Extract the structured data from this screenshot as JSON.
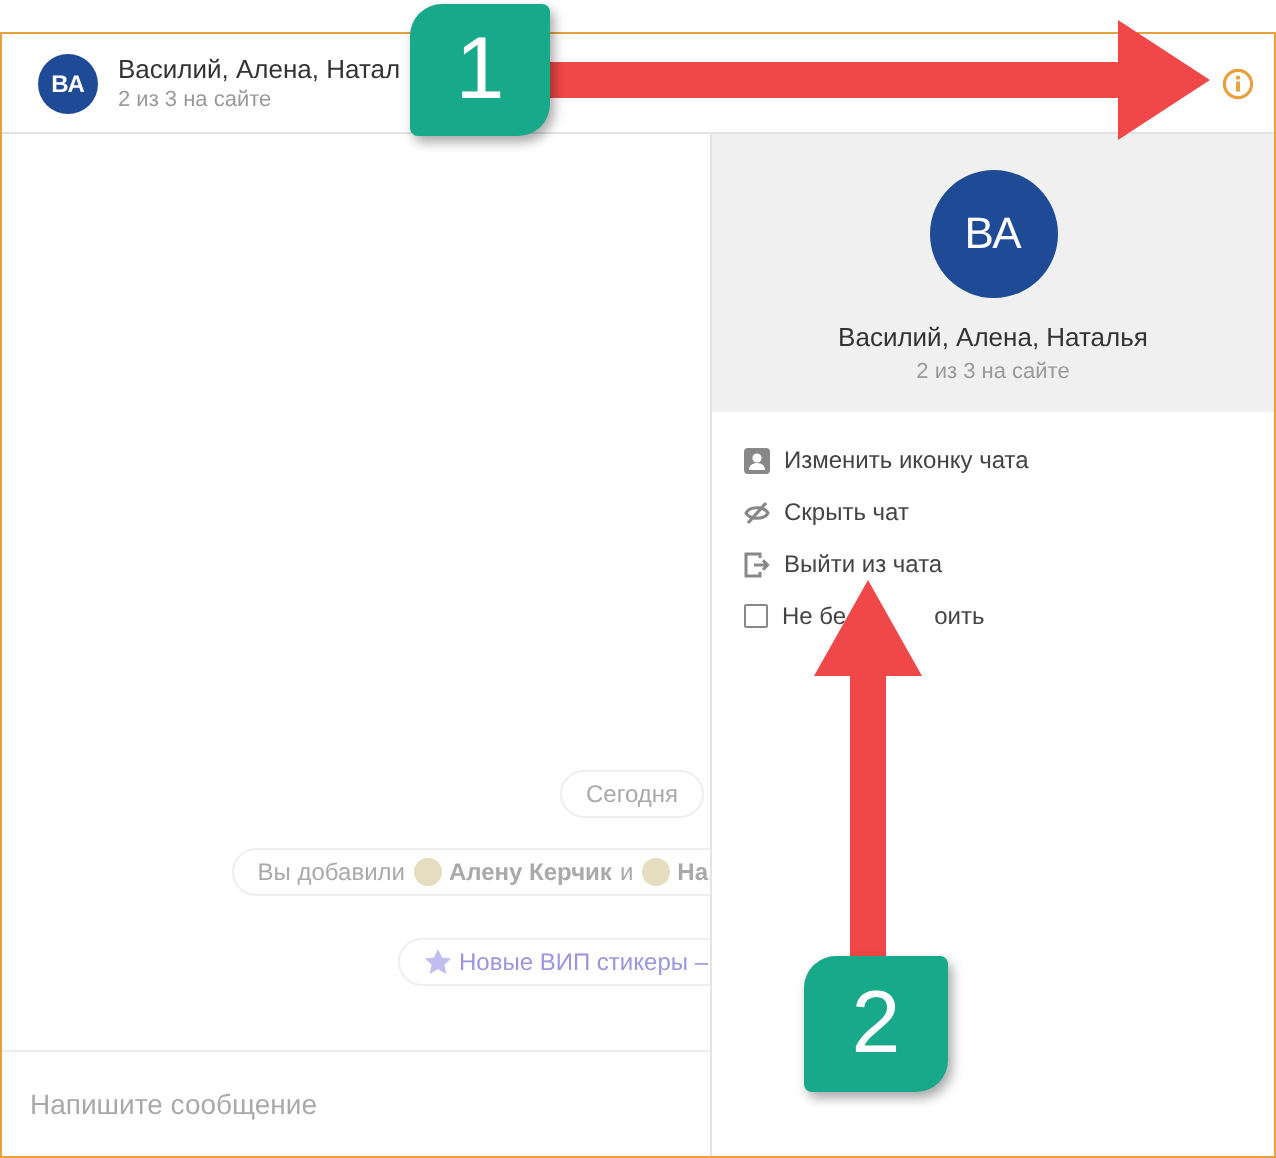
{
  "header": {
    "avatar": "ВА",
    "title": "Василий, Алена, Натал",
    "status": "2 из 3 на сайте"
  },
  "chat": {
    "date": "Сегодня",
    "added": {
      "prefix": "Вы добавили",
      "name": "Алену Керчик",
      "joiner": "и",
      "cut": "На"
    },
    "promo": "Новые ВИП стикеры –"
  },
  "composer": {
    "placeholder": "Напишите сообщение"
  },
  "info_panel": {
    "avatar": "ВА",
    "name": "Василий, Алена, Наталья",
    "status": "2 из 3 на сайте",
    "actions": [
      {
        "kind": "person",
        "label": "Изменить иконку чата"
      },
      {
        "kind": "hide",
        "label": "Скрыть чат"
      },
      {
        "kind": "exit",
        "label": "Выйти из чата"
      },
      {
        "kind": "checkbox",
        "label": "Не бе",
        "label_tail": "оить",
        "checked": false
      }
    ]
  },
  "annotations": [
    {
      "number": "1",
      "kind": "right_arrow"
    },
    {
      "number": "2",
      "kind": "up_arrow"
    }
  ]
}
